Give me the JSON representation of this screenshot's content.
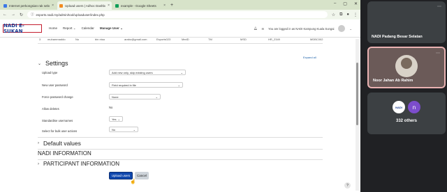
{
  "browser": {
    "tabs": [
      {
        "label": "Internet perkongsian rak sebut",
        "fav": "#3b78e7",
        "active": false
      },
      {
        "label": "Upload users | Adhoc Dashboard",
        "fav": "#f28b21",
        "active": true
      },
      {
        "label": "example - Google Sheets",
        "fav": "#0f9d58",
        "active": false
      }
    ],
    "url": "esports.nadi.my/admin/tool/uploaduser/index.php"
  },
  "nav": {
    "logo": "NADI E-SUKAN",
    "menu": [
      "Home",
      "Report",
      "Calendar",
      "Manage User"
    ],
    "login_text": "You are logged in as NADI Kampung Kuala Sungai"
  },
  "table_row": [
    "3",
    "muhammaddo",
    "No",
    "bin nisa",
    "arabo@gmail.com",
    "Esports023",
    "MedD",
    "TM",
    "MSD",
    "HR_2349",
    "MDBC002"
  ],
  "expand_all": "Expand all",
  "settings": {
    "title": "Settings",
    "fields": [
      {
        "label": "Upload type",
        "value": "Add new only, skip existing users",
        "kind": "select",
        "width": 110
      },
      {
        "label": "New user password",
        "value": "Field required in file",
        "kind": "select",
        "width": 106
      },
      {
        "label": "Force password change",
        "value": "None",
        "kind": "select",
        "width": 74
      },
      {
        "label": "Allow deletes",
        "value": "No",
        "kind": "text"
      },
      {
        "label": "Standardise usernames",
        "value": "Yes",
        "kind": "select",
        "width": 20
      },
      {
        "label": "Select for bulk user actions",
        "value": "No",
        "kind": "select",
        "width": 42
      }
    ]
  },
  "sections": {
    "default_values": "Default values",
    "nadi_information": "NADI INFORMATION",
    "participant_information": "PARTICIPANT INFORMATION"
  },
  "buttons": {
    "upload": "Upload users",
    "cancel": "Cancel"
  },
  "help": "?",
  "meet": {
    "participants": [
      {
        "name": "NADI Padang Besar Selatan"
      },
      {
        "name": "Noor Jahan Ab Rahim"
      }
    ],
    "others": {
      "initial": "n",
      "label": "332 others",
      "mini_logo": "NADI"
    }
  }
}
